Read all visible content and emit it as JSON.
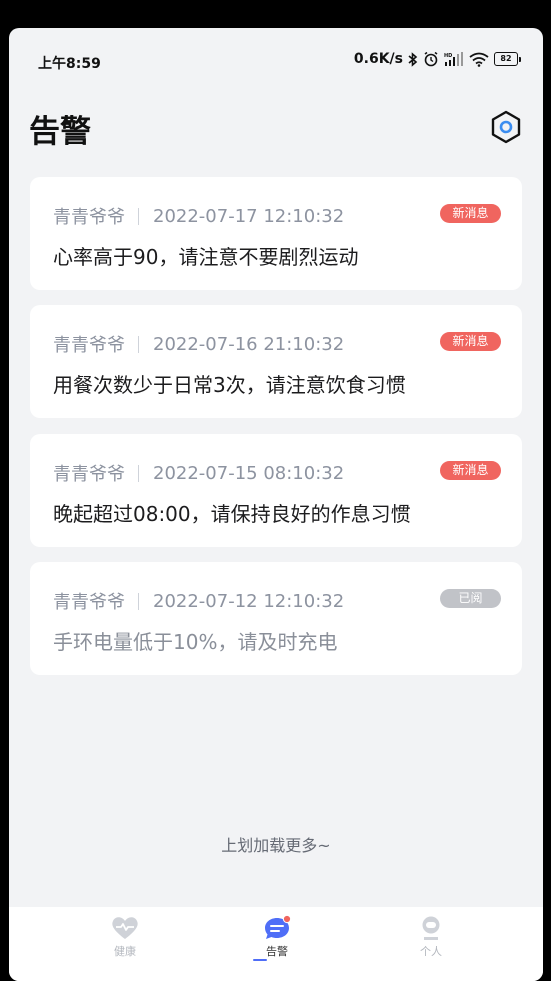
{
  "status_bar": {
    "time": "上午8:59",
    "network_speed": "0.6K/s",
    "battery": "82"
  },
  "header": {
    "title": "告警",
    "settings_icon": "settings-hex-icon"
  },
  "alerts": [
    {
      "name": "青青爷爷",
      "time": "2022-07-17 12:10:32",
      "badge": "新消息",
      "state": "new",
      "message": "心率高于90，请注意不要剧烈运动"
    },
    {
      "name": "青青爷爷",
      "time": "2022-07-16 21:10:32",
      "badge": "新消息",
      "state": "new",
      "message": "用餐次数少于日常3次，请注意饮食习惯"
    },
    {
      "name": "青青爷爷",
      "time": "2022-07-15 08:10:32",
      "badge": "新消息",
      "state": "new",
      "message": "晚起超过08:00，请保持良好的作息习惯"
    },
    {
      "name": "青青爷爷",
      "time": "2022-07-12 12:10:32",
      "badge": "已阅",
      "state": "read",
      "message": "手环电量低于10%，请及时充电"
    }
  ],
  "load_more": "上划加载更多~",
  "tabs": [
    {
      "label": "健康",
      "icon": "heart-icon",
      "active": false
    },
    {
      "label": "告警",
      "icon": "message-icon",
      "active": true
    },
    {
      "label": "个人",
      "icon": "person-icon",
      "active": false
    }
  ],
  "colors": {
    "accent": "#4f6ef7",
    "badge_new": "#f0655f",
    "badge_read": "#c1c3c8",
    "background": "#f2f3f5"
  }
}
